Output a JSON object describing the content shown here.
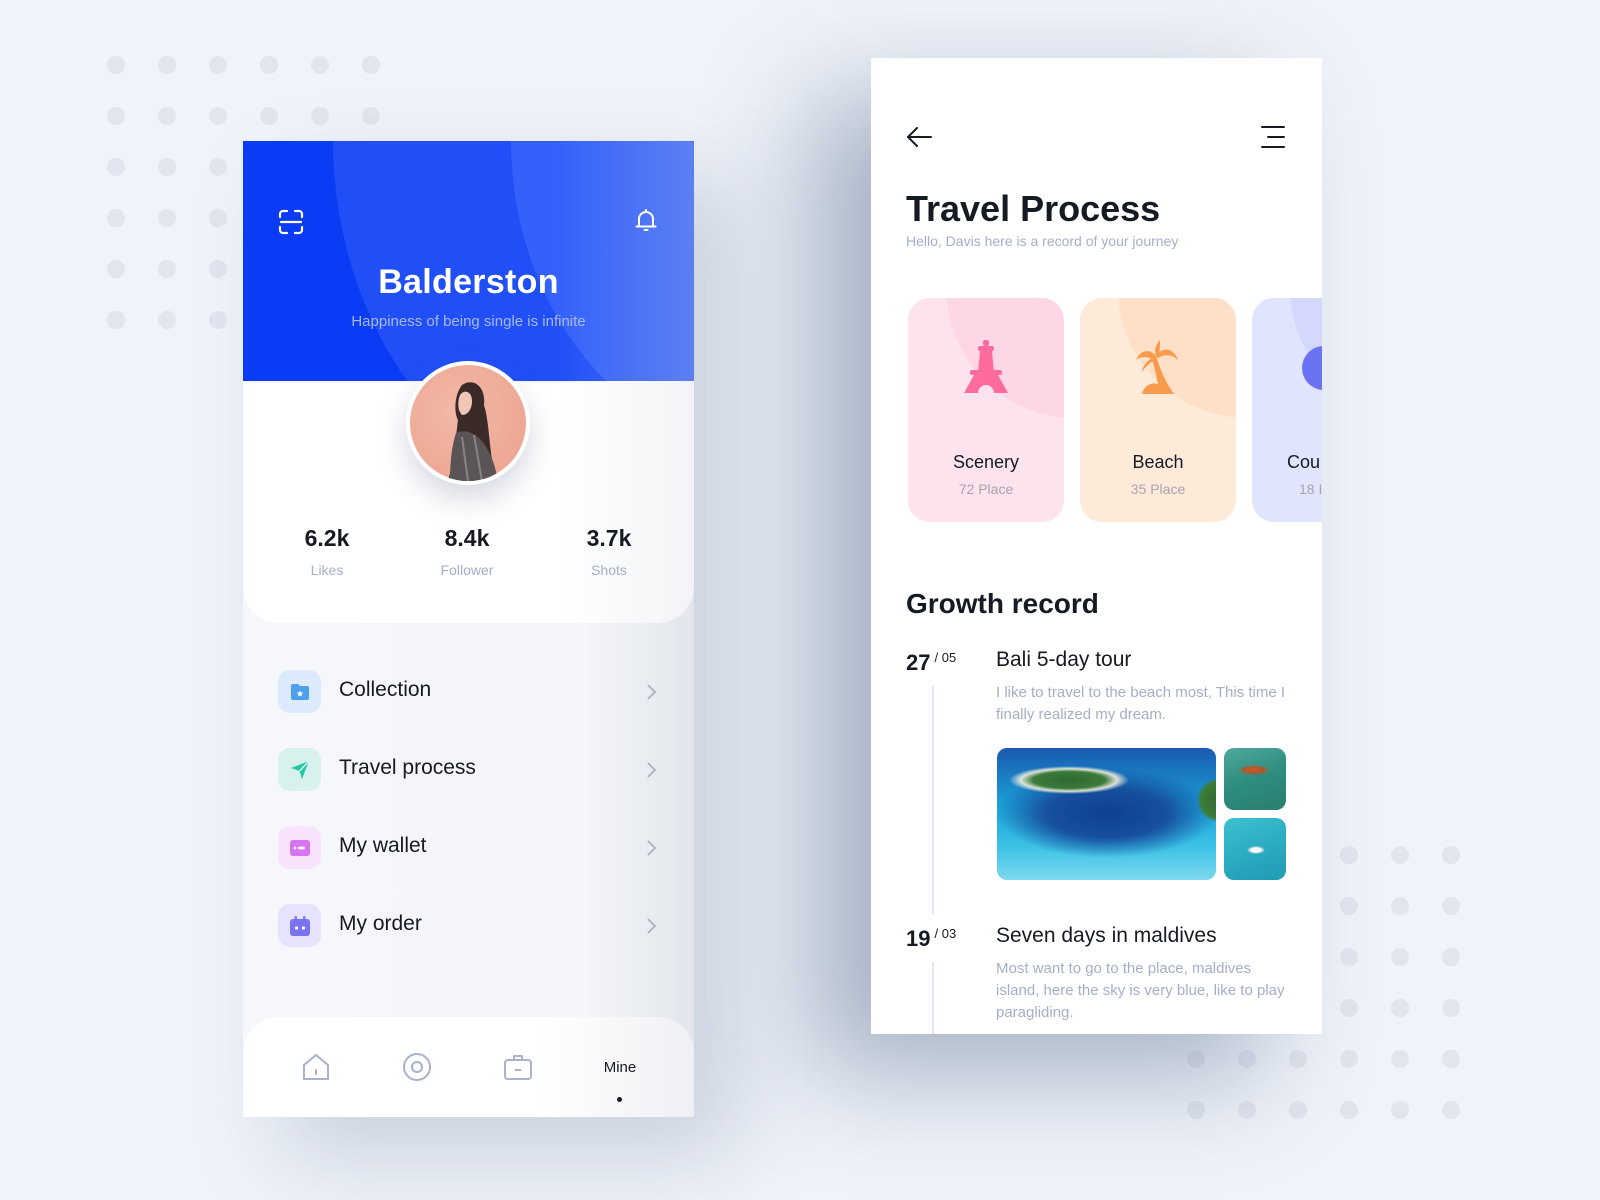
{
  "profile_screen": {
    "header": {
      "scan_icon": "scan-icon",
      "bell_icon": "bell-icon",
      "name": "Balderston",
      "bio": "Happiness of being single is infinite",
      "hero_color": "#0a3cf5"
    },
    "avatar": {
      "alt": "profile photo"
    },
    "stats": [
      {
        "value": "6.2k",
        "label": "Likes"
      },
      {
        "value": "8.4k",
        "label": "Follower"
      },
      {
        "value": "3.7k",
        "label": "Shots"
      }
    ],
    "menu": [
      {
        "label": "Collection",
        "icon": "folder-star-icon",
        "icon_color": "#4ea0ec",
        "bg_color": "#dceafd"
      },
      {
        "label": "Travel process",
        "icon": "paper-plane-icon",
        "icon_color": "#25c7a5",
        "bg_color": "#d7f2ec"
      },
      {
        "label": "My wallet",
        "icon": "wallet-icon",
        "icon_color": "#d775f0",
        "bg_color": "#f8e3fc"
      },
      {
        "label": "My order",
        "icon": "calendar-icon",
        "icon_color": "#7a73f2",
        "bg_color": "#e5e4fc"
      }
    ],
    "tabbar": {
      "tabs": [
        {
          "name": "home",
          "icon": "home-icon"
        },
        {
          "name": "discover",
          "icon": "target-icon"
        },
        {
          "name": "trips",
          "icon": "briefcase-icon"
        },
        {
          "name": "mine",
          "label": "Mine",
          "active": true
        }
      ]
    }
  },
  "travel_screen": {
    "back_icon": "arrow-left-icon",
    "menu_icon": "menu-icon",
    "title": "Travel Process",
    "subtitle": "Hello, Davis here is a record of your journey",
    "categories": [
      {
        "name": "Scenery",
        "count": "72 Place",
        "icon": "eiffel-tower-icon",
        "color": "#fe6b9c",
        "bg": "#fde3ee",
        "blob": "#fdd7e5"
      },
      {
        "name": "Beach",
        "count": "35 Place",
        "icon": "palm-tree-icon",
        "color": "#f79a4c",
        "bg": "#feead9",
        "blob": "#fde0c7"
      },
      {
        "name": "Cou",
        "count": "18 I",
        "icon": "globe-icon",
        "color": "#6a74f3",
        "bg": "#e1e4fd",
        "blob": "#d3d8fc"
      }
    ],
    "growth_title": "Growth record",
    "entries": [
      {
        "day": "27",
        "month": "/ 05",
        "title": "Bali 5-day tour",
        "desc": "I like to travel to the beach most,  This time I finally realized my dream."
      },
      {
        "day": "19",
        "month": "/ 03",
        "title": "Seven days in maldives",
        "desc": "Most want to go to the place, maldives island, here the sky is very blue, like to play paragliding."
      }
    ]
  }
}
